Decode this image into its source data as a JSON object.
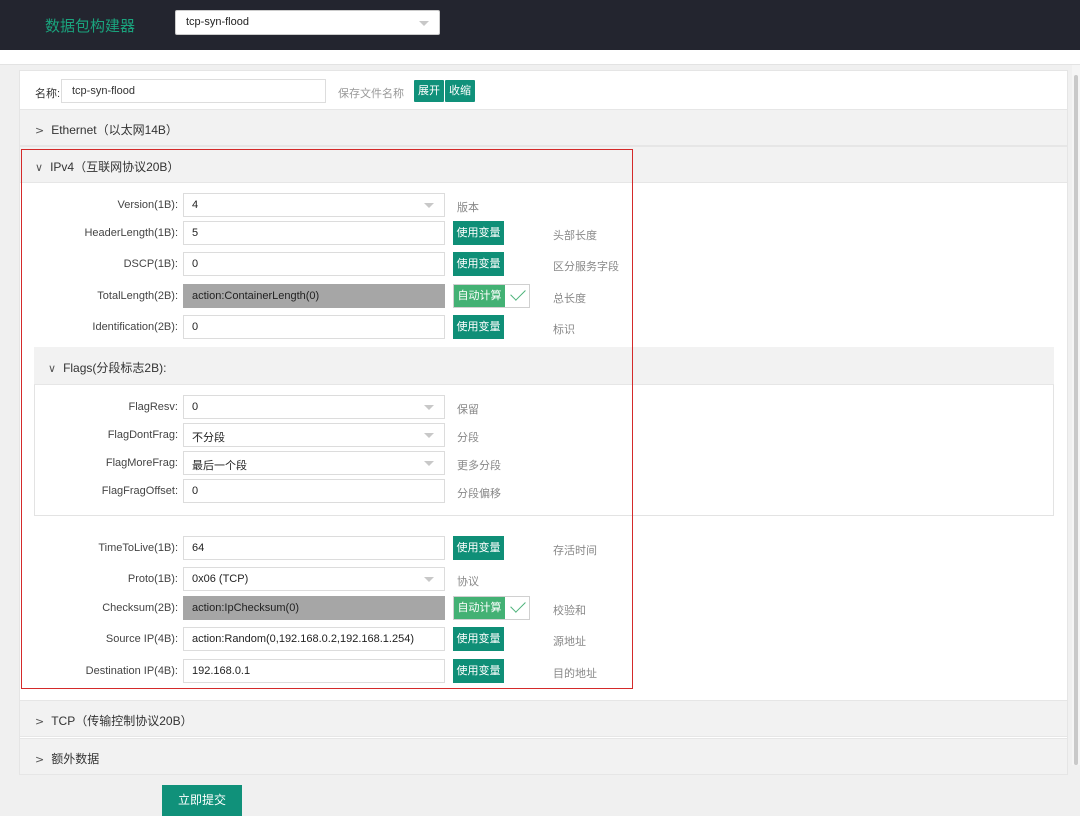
{
  "header": {
    "app_title": "数据包构建器",
    "template_select": "tcp-syn-flood"
  },
  "toolbar": {
    "name_label": "名称:",
    "name_value": "tcp-syn-flood",
    "save_hint": "保存文件名称",
    "expand_label": "展开",
    "collapse_label": "收缩"
  },
  "sections": {
    "ethernet": "Ethernet（以太网14B）",
    "ipv4": "IPv4（互联网协议20B）",
    "tcp": "TCP（传输控制协议20B）",
    "extra": "额外数据"
  },
  "buttons": {
    "use_var": "使用变量",
    "auto_calc": "自动计算",
    "submit": "立即提交"
  },
  "ipv4": {
    "version": {
      "label": "Version(1B):",
      "value": "4",
      "desc": "版本"
    },
    "header_length": {
      "label": "HeaderLength(1B):",
      "value": "5",
      "desc": "头部长度"
    },
    "dscp": {
      "label": "DSCP(1B):",
      "value": "0",
      "desc": "区分服务字段"
    },
    "total_length": {
      "label": "TotalLength(2B):",
      "value": "action:ContainerLength(0)",
      "desc": "总长度"
    },
    "identification": {
      "label": "Identification(2B):",
      "value": "0",
      "desc": "标识"
    },
    "flags": {
      "title": "Flags(分段标志2B):",
      "resv": {
        "label": "FlagResv:",
        "value": "0",
        "desc": "保留"
      },
      "dont_frag": {
        "label": "FlagDontFrag:",
        "value": "不分段",
        "desc": "分段"
      },
      "more_frag": {
        "label": "FlagMoreFrag:",
        "value": "最后一个段",
        "desc": "更多分段"
      },
      "frag_offset": {
        "label": "FlagFragOffset:",
        "value": "0",
        "desc": "分段偏移"
      }
    },
    "ttl": {
      "label": "TimeToLive(1B):",
      "value": "64",
      "desc": "存活时间"
    },
    "proto": {
      "label": "Proto(1B):",
      "value": "0x06 (TCP)",
      "desc": "协议"
    },
    "checksum": {
      "label": "Checksum(2B):",
      "value": "action:IpChecksum(0)",
      "desc": "校验和"
    },
    "source_ip": {
      "label": "Source IP(4B):",
      "value": "action:Random(0,192.168.0.2,192.168.1.254)",
      "desc": "源地址"
    },
    "dest_ip": {
      "label": "Destination IP(4B):",
      "value": "192.168.0.1",
      "desc": "目的地址"
    }
  }
}
